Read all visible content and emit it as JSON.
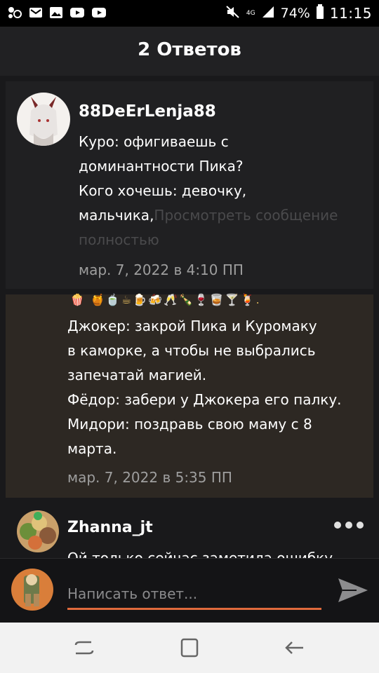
{
  "status_bar": {
    "network": "4G",
    "battery": "74%",
    "time": "11:15"
  },
  "header": {
    "title": "2 Ответов"
  },
  "comments": [
    {
      "username": "88DeErLenja88",
      "lines": [
        "Куро: офигиваешь с",
        "доминантности Пика?",
        "Кого хочешь: девочку,",
        "мальчика,"
      ],
      "view_more": "Просмотреть сообщение",
      "view_more_cont": "полностью",
      "timestamp": "мар. 7, 2022 в 4:10 ПП"
    },
    {
      "emoji_row": "🍿 🍯🍵☕🍺🍻🥂🍾🍷🥃🍸🍹.",
      "lines": [
        "Джокер: закрой Пика и Куромаку",
        "в каморке, а чтобы не выбрались",
        "запечатай магией.",
        "Фёдор: забери у Джокера его палку.",
        "Мидори: поздравь свою маму с 8",
        "марта."
      ],
      "timestamp": "мар. 7, 2022 в 5:35 ПП"
    },
    {
      "username": "Zhanna_jt",
      "preview": "Ой только сейчас заметила ошибку"
    }
  ],
  "reply": {
    "placeholder": "Написать ответ..."
  },
  "colors": {
    "accent": "#e06a3c",
    "highlight_bg": "#2d2823",
    "card_bg": "#202022"
  },
  "icons": [
    "person-icon",
    "gallery-icon",
    "youtube-icon",
    "mute-icon",
    "signal-icon",
    "battery-icon",
    "send-icon",
    "recent-apps-icon",
    "home-icon",
    "back-icon",
    "more-icon"
  ]
}
